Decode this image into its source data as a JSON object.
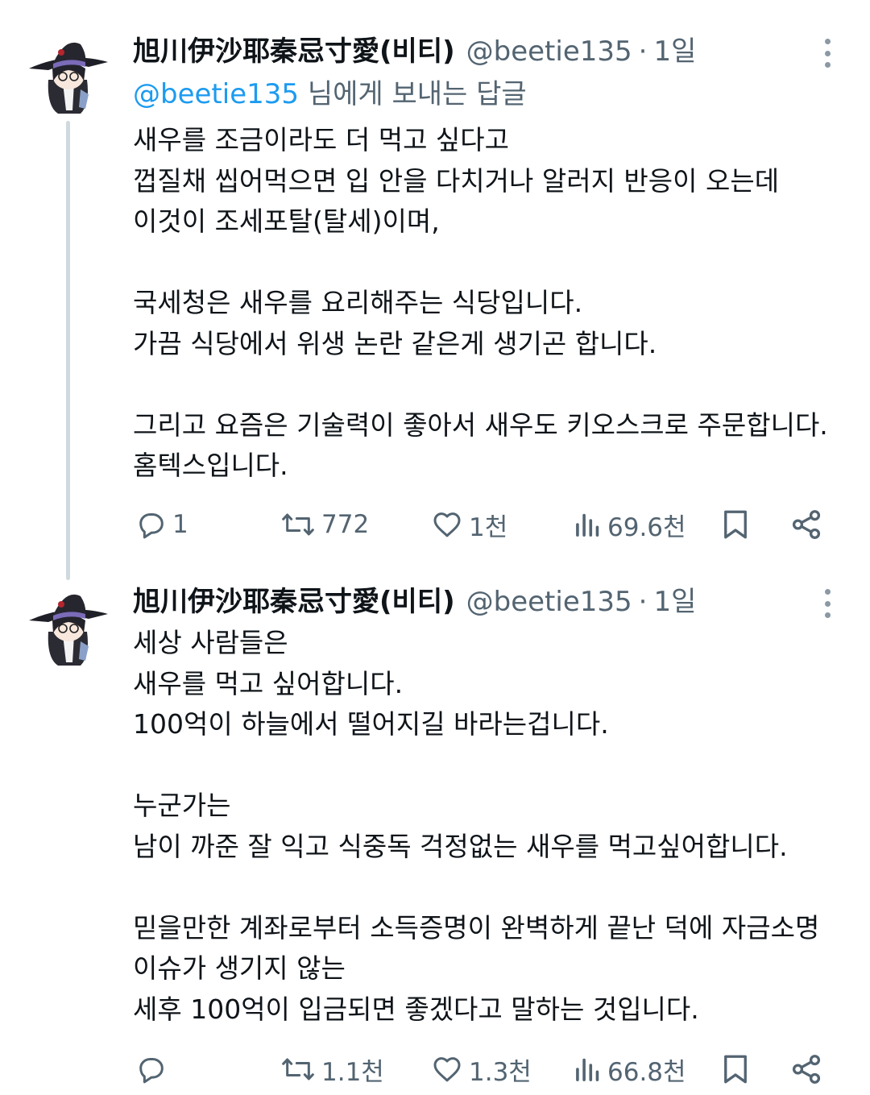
{
  "tweets": [
    {
      "display_name": "旭川伊沙耶秦忌寸愛(비티)",
      "handle": "@beetie135",
      "separator": "·",
      "age": "1일",
      "replying_mention": "@beetie135",
      "replying_suffix": " 님에게 보내는 답글",
      "lines": [
        "새우를 조금이라도 더 먹고 싶다고",
        "껍질채 씹어먹으면 입 안을 다치거나 알러지 반응이 오는데",
        "이것이 조세포탈(탈세)이며,",
        "",
        "국세청은 새우를 요리해주는 식당입니다.",
        "가끔 식당에서 위생 논란 같은게 생기곤 합니다.",
        "",
        "그리고 요즘은 기술력이 좋아서 새우도 키오스크로 주문합니다.",
        "홈텍스입니다."
      ],
      "actions": {
        "replies": "1",
        "retweets": "772",
        "likes": "1천",
        "views": "69.6천"
      }
    },
    {
      "display_name": "旭川伊沙耶秦忌寸愛(비티)",
      "handle": "@beetie135",
      "separator": "·",
      "age": "1일",
      "lines": [
        "세상 사람들은",
        "새우를 먹고 싶어합니다.",
        "100억이 하늘에서 떨어지길 바라는겁니다.",
        "",
        "누군가는",
        "남이 까준 잘 익고 식중독 걱정없는 새우를 먹고싶어합니다.",
        "",
        "믿을만한 계좌로부터 소득증명이 완벽하게 끝난 덕에 자금소명",
        "이슈가 생기지 않는",
        "세후 100억이 입금되면 좋겠다고 말하는 것입니다."
      ],
      "actions": {
        "replies": "",
        "retweets": "1.1천",
        "likes": "1.3천",
        "views": "66.8천"
      }
    }
  ],
  "icons": {
    "reply": "reply-icon",
    "retweet": "retweet-icon",
    "like": "heart-icon",
    "views": "views-icon",
    "bookmark": "bookmark-icon",
    "share": "share-icon",
    "more": "more-icon"
  },
  "colors": {
    "text": "#0f1419",
    "secondary": "#536471",
    "link": "#1d9bf0",
    "thread_line": "#cfd9de"
  }
}
